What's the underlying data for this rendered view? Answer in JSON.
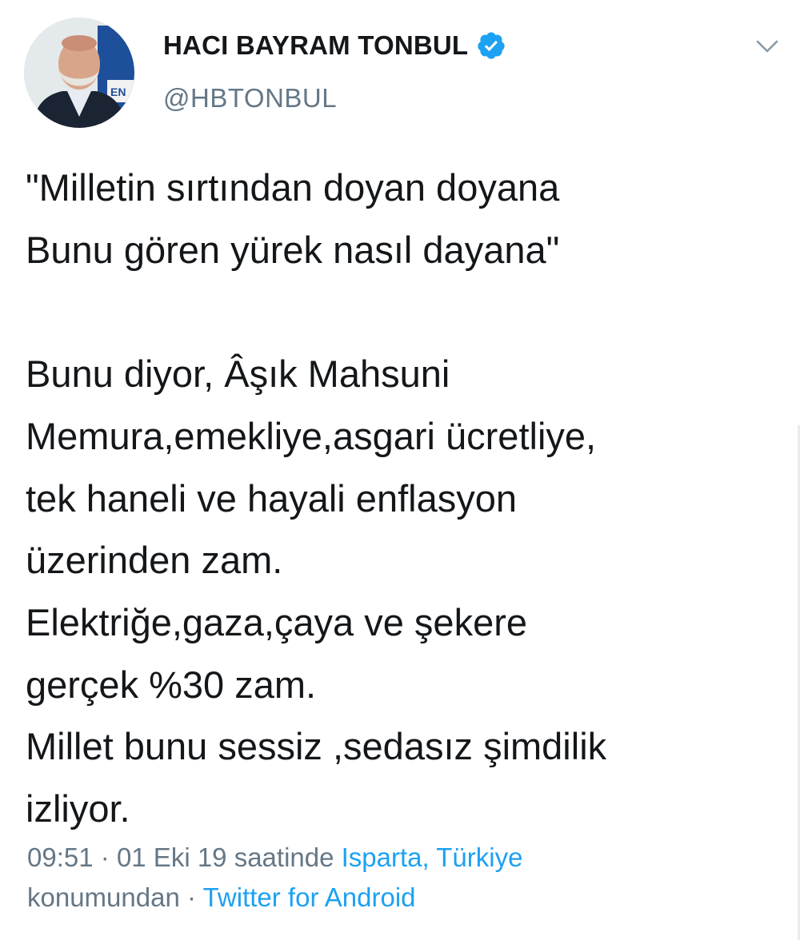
{
  "author": {
    "display_name": "HACI BAYRAM TONBUL",
    "handle": "@HBTONBUL",
    "verified": true,
    "avatar_icon": "profile-photo",
    "verified_icon": "verified-badge-icon"
  },
  "menu": {
    "icon": "chevron-down-icon"
  },
  "tweet": {
    "lines": [
      "\"Milletin sırtından doyan doyana",
      "Bunu gören yürek nasıl dayana\"",
      "",
      "Bunu diyor, Âşık Mahsuni",
      "Memura,emekliye,asgari ücretliye,",
      "tek haneli ve hayali enflasyon",
      "üzerinden zam.",
      "Elektriğe,gaza,çaya ve şekere",
      "gerçek %30 zam.",
      "Millet bunu sessiz ,sedasız şimdilik",
      "izliyor."
    ]
  },
  "meta": {
    "time": "09:51",
    "separator": "·",
    "date_text": "01 Eki 19 saatinde",
    "location": "Isparta, Türkiye",
    "location_suffix": "konumundan",
    "source": "Twitter for Android"
  },
  "colors": {
    "text": "#14171a",
    "secondary": "#657786",
    "link": "#1da1f2",
    "verified": "#1da1f2"
  }
}
